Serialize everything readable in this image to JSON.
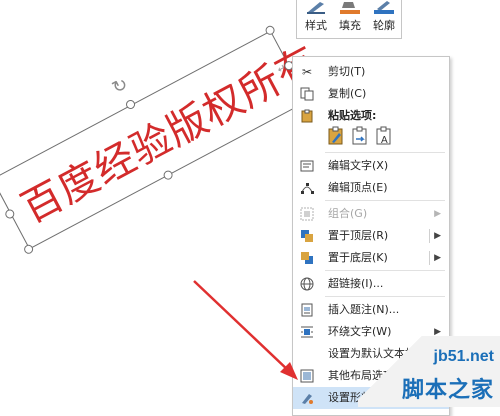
{
  "shape": {
    "text": "百度经验版权所有"
  },
  "mini_toolbar": {
    "buttons": [
      {
        "label": "样式"
      },
      {
        "label": "填充"
      },
      {
        "label": "轮廓"
      }
    ]
  },
  "context_menu": {
    "items": {
      "cut": "剪切(T)",
      "copy": "复制(C)",
      "paste_options": "粘贴选项:",
      "edit_text": "编辑文字(X)",
      "edit_points": "编辑顶点(E)",
      "group": "组合(G)",
      "bring_to_front": "置于顶层(R)",
      "send_to_back": "置于底层(K)",
      "hyperlink": "超链接(I)...",
      "insert_caption": "插入题注(N)...",
      "wrap_text": "环绕文字(W)",
      "set_default_textbox": "设置为默认文本框(D)",
      "more_layout": "其他布局选项",
      "format_shape": "设置形状格式"
    }
  },
  "watermark": {
    "url": "jb51.net",
    "name": "脚本之家"
  },
  "colors": {
    "shape_text": "#d32b2b",
    "arrow": "#e03030",
    "highlight": "#cfe3f7",
    "watermark": "#1b6fb8"
  }
}
